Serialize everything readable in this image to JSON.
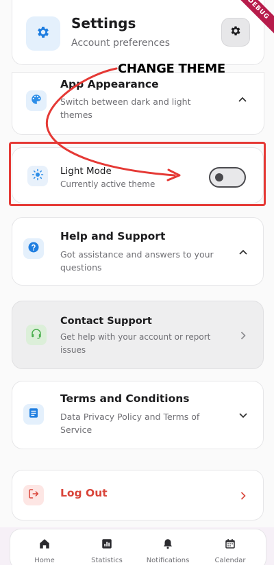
{
  "header": {
    "title": "Settings",
    "subtitle": "Account preferences",
    "icon": "gear-icon",
    "action_icon": "gear-icon"
  },
  "debug_banner": "DEBUG",
  "annotation": {
    "label": "CHANGE THEME",
    "color": "#e53935"
  },
  "sections": {
    "appearance": {
      "title": "App Appearance",
      "subtitle": "Switch between dark and light themes",
      "icon": "palette-icon",
      "accent": "#2d8ee8"
    },
    "light_mode": {
      "title": "Light Mode",
      "subtitle": "Currently active theme",
      "icon": "sun-icon",
      "toggle_on": false
    },
    "help": {
      "title": "Help and Support",
      "subtitle": "Got assistance and answers to your questions",
      "icon": "question-icon"
    },
    "contact": {
      "title": "Contact Support",
      "subtitle": "Get help with your account or report issues",
      "icon": "headset-icon",
      "accent": "#4caf50"
    },
    "terms": {
      "title": "Terms and Conditions",
      "subtitle": "Data Privacy Policy and Terms of Service",
      "icon": "document-icon"
    },
    "logout": {
      "title": "Log Out",
      "icon": "logout-icon",
      "accent": "#d9453a"
    }
  },
  "nav": {
    "items": [
      {
        "label": "Home",
        "icon": "home-icon"
      },
      {
        "label": "Statistics",
        "icon": "chart-icon"
      },
      {
        "label": "Notifications",
        "icon": "bell-icon"
      },
      {
        "label": "Calendar",
        "icon": "calendar-icon"
      }
    ]
  }
}
